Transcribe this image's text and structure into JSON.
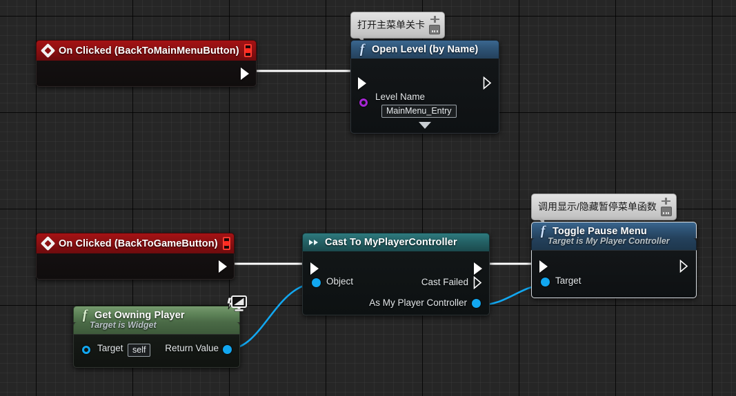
{
  "app": {
    "title": "Unreal Engine Blueprint Event Graph",
    "background_color": "#262626",
    "grid_minor": 14,
    "grid_major": 140
  },
  "nodes": [
    {
      "id": "on-clicked-backtomainmenu",
      "kind": "event",
      "title": "On Clicked (BackToMainMenuButton)",
      "icon": "event-diamond-icon",
      "delegate_icon": "delegate-square-icon",
      "out_exec": "exec-out-pin"
    },
    {
      "id": "open-level-by-name",
      "kind": "function",
      "title": "Open Level (by Name)",
      "icon": "function-f-icon",
      "in_exec": "exec-in-pin",
      "out_exec": "exec-out-pin",
      "inputs": [
        {
          "label": "Level Name",
          "value": "MainMenu_Entry",
          "pin_type": "name",
          "pin_color": "#a626d4"
        }
      ],
      "expander": "expand-caret-icon"
    },
    {
      "id": "on-clicked-backtogame",
      "kind": "event",
      "title": "On Clicked (BackToGameButton)",
      "icon": "event-diamond-icon",
      "delegate_icon": "delegate-square-icon",
      "out_exec": "exec-out-pin"
    },
    {
      "id": "cast-to-myplayercontroller",
      "kind": "cast",
      "title": "Cast To MyPlayerController",
      "icon": "cast-arrows-icon",
      "in_exec": "exec-in-pin",
      "out_exec": "exec-out-pin",
      "inputs": [
        {
          "label": "Object",
          "pin_type": "object",
          "pin_color": "#12a7f0"
        }
      ],
      "outputs": [
        {
          "label": "Cast Failed",
          "pin_type": "exec"
        },
        {
          "label": "As My Player Controller",
          "pin_type": "object",
          "pin_color": "#12a7f0"
        }
      ]
    },
    {
      "id": "toggle-pause-menu",
      "kind": "function",
      "selected": true,
      "title": "Toggle Pause Menu",
      "subtitle": "Target is My Player Controller",
      "icon": "function-f-icon",
      "in_exec": "exec-in-pin",
      "out_exec": "exec-out-pin",
      "inputs": [
        {
          "label": "Target",
          "pin_type": "object",
          "pin_color": "#12a7f0"
        }
      ]
    },
    {
      "id": "get-owning-player",
      "kind": "pure",
      "title": "Get Owning Player",
      "subtitle": "Target is Widget",
      "icon": "function-f-icon",
      "badge": "client-only-monitor-icon",
      "inputs": [
        {
          "label": "Target",
          "value": "self",
          "pin_type": "object",
          "pin_color": "#12a7f0"
        }
      ],
      "outputs": [
        {
          "label": "Return Value",
          "pin_type": "object",
          "pin_color": "#12a7f0"
        }
      ]
    }
  ],
  "comments": [
    {
      "id": "comment-open-main-menu-level",
      "text": "打开主菜单关卡",
      "icons": [
        "pin-icon",
        "note-icon"
      ],
      "attached_to": "open-level-by-name"
    },
    {
      "id": "comment-toggle-pause-menu",
      "text": "调用显示/隐藏暂停菜单函数",
      "icons": [
        "pin-icon",
        "note-icon"
      ],
      "attached_to": "toggle-pause-menu"
    }
  ],
  "wires": [
    {
      "id": "wire-mainmenu-exec",
      "from": "on-clicked-backtomainmenu.exec-out",
      "to": "open-level-by-name.exec-in",
      "type": "exec",
      "color": "#ffffff"
    },
    {
      "id": "wire-backtogame-exec",
      "from": "on-clicked-backtogame.exec-out",
      "to": "cast-to-myplayercontroller.exec-in",
      "type": "exec",
      "color": "#ffffff"
    },
    {
      "id": "wire-cast-exec",
      "from": "cast-to-myplayercontroller.exec-out",
      "to": "toggle-pause-menu.exec-in",
      "type": "exec",
      "color": "#ffffff"
    },
    {
      "id": "wire-owningplayer-object",
      "from": "get-owning-player.return-value",
      "to": "cast-to-myplayercontroller.object",
      "type": "data",
      "color": "#12a7f0"
    },
    {
      "id": "wire-cast-target",
      "from": "cast-to-myplayercontroller.as-my-player-controller",
      "to": "toggle-pause-menu.target",
      "type": "data",
      "color": "#12a7f0"
    }
  ]
}
